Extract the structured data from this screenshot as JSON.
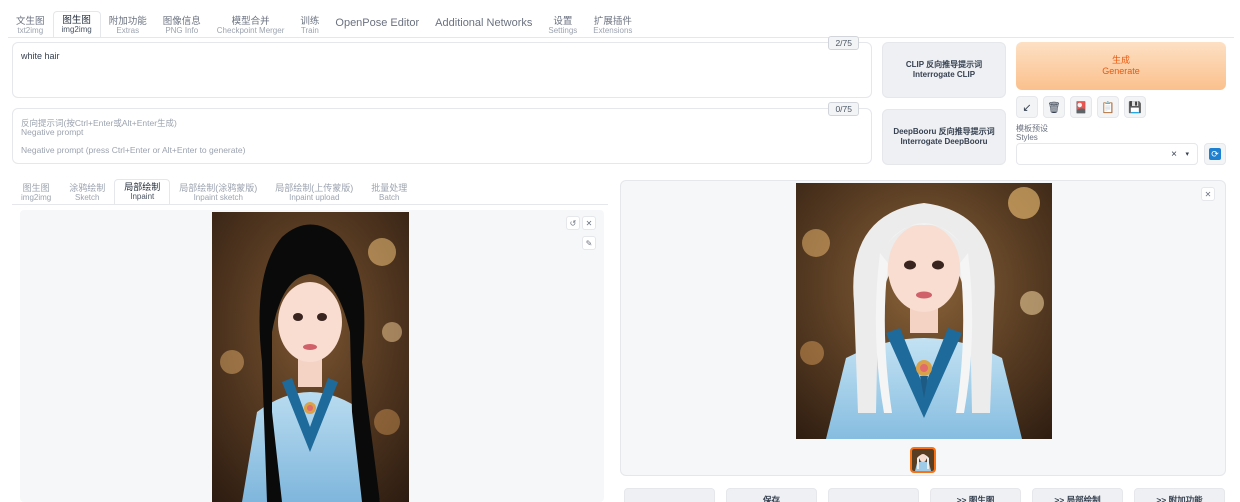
{
  "top_tabs": [
    {
      "zh": "文生图",
      "en": "txt2img"
    },
    {
      "zh": "图生图",
      "en": "img2img"
    },
    {
      "zh": "附加功能",
      "en": "Extras"
    },
    {
      "zh": "图像信息",
      "en": "PNG Info"
    },
    {
      "zh": "模型合并",
      "en": "Checkpoint Merger"
    },
    {
      "zh": "训练",
      "en": "Train"
    },
    {
      "label": "OpenPose Editor"
    },
    {
      "label": "Additional Networks"
    },
    {
      "zh": "设置",
      "en": "Settings"
    },
    {
      "zh": "扩展插件",
      "en": "Extensions"
    }
  ],
  "prompt": {
    "value": "white hair",
    "counter": "2/75"
  },
  "negative_prompt": {
    "label_zh": "反向提示词(按Ctrl+Enter或Alt+Enter生成)",
    "label_en": "Negative prompt",
    "placeholder": "Negative prompt (press Ctrl+Enter or Alt+Enter to generate)",
    "counter": "0/75"
  },
  "interrogate": {
    "clip_zh": "CLIP 反向推导提示词",
    "clip_en": "Interrogate CLIP",
    "deep_zh": "DeepBooru 反向推导提示词",
    "deep_en": "Interrogate DeepBooru"
  },
  "generate": {
    "zh": "生成",
    "en": "Generate"
  },
  "tools": [
    {
      "icon": "arrow-icon",
      "glyph": "↙"
    },
    {
      "icon": "trash-icon",
      "glyph": "🗑"
    },
    {
      "icon": "extra-networks-icon",
      "glyph": "🎴"
    },
    {
      "icon": "clipboard-icon",
      "glyph": "📋"
    },
    {
      "icon": "save-style-icon",
      "glyph": "💾"
    }
  ],
  "styles": {
    "label_zh": "模板预设",
    "label_en": "Styles",
    "clear": "×",
    "chevron": "▾",
    "refresh": "⟳"
  },
  "sub_tabs": [
    {
      "zh": "图生图",
      "en": "img2img"
    },
    {
      "zh": "涂鸦绘制",
      "en": "Sketch"
    },
    {
      "zh": "局部绘制",
      "en": "Inpaint"
    },
    {
      "zh": "局部绘制(涂鸦蒙版)",
      "en": "Inpaint sketch"
    },
    {
      "zh": "局部绘制(上传蒙版)",
      "en": "Inpaint upload"
    },
    {
      "zh": "批量处理",
      "en": "Batch"
    }
  ],
  "canvas_controls": {
    "undo": "↺",
    "close": "✕",
    "brush": "✎"
  },
  "output": {
    "close": "✕"
  },
  "output_buttons": [
    "",
    "保存",
    "",
    ">> 图生图",
    ">> 局部绘制",
    ">> 附加功能"
  ]
}
